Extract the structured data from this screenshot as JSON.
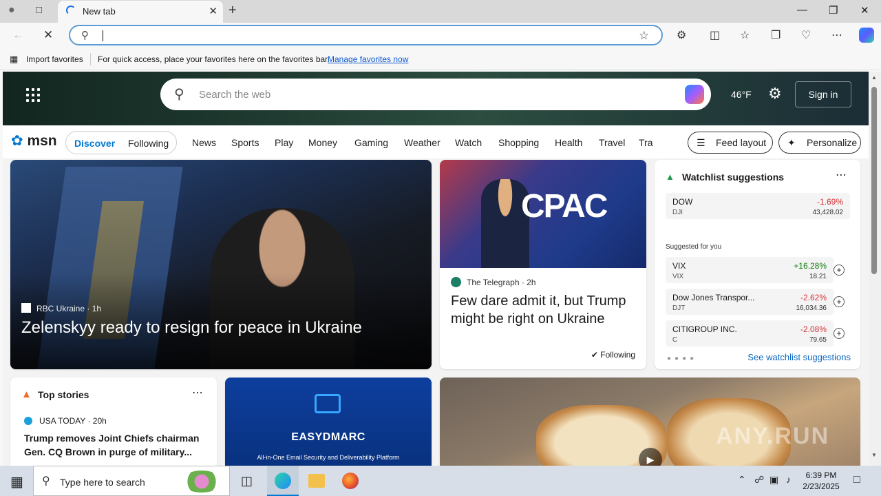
{
  "browser": {
    "tab_title": "New tab",
    "address_value": "",
    "favorites_bar": {
      "import_label": "Import favorites",
      "message": "For quick access, place your favorites here on the favorites bar.",
      "link": "Manage favorites now"
    }
  },
  "msn": {
    "search_placeholder": "Search the web",
    "temperature": "46°F",
    "sign_in": "Sign in",
    "logo": "msn",
    "tabs": {
      "discover": "Discover",
      "following": "Following"
    },
    "nav": [
      "News",
      "Sports",
      "Play",
      "Money",
      "Gaming",
      "Weather",
      "Watch",
      "Shopping",
      "Health",
      "Travel",
      "Tra"
    ],
    "feed_layout": "Feed layout",
    "personalize": "Personalize",
    "hero": {
      "source": "RBC Ukraine · 1h",
      "headline": "Zelenskyy ready to resign for peace in Ukraine"
    },
    "cpac": {
      "image_text": "CPAC",
      "source": "The Telegraph · 2h",
      "headline": "Few dare admit it, but Trump might be right on Ukraine",
      "following": "Following"
    },
    "watchlist": {
      "title": "Watchlist suggestions",
      "suggested_label": "Suggested for you",
      "see_more": "See watchlist suggestions",
      "items": [
        {
          "name": "DOW",
          "symbol": "DJI",
          "change": "-1.69%",
          "price": "43,428.02"
        },
        {
          "name": "VIX",
          "symbol": "VIX",
          "change": "+16.28%",
          "price": "18.21"
        },
        {
          "name": "Dow Jones Transpor...",
          "symbol": "DJT",
          "change": "-2.62%",
          "price": "16,034.36"
        },
        {
          "name": "CITIGROUP INC.",
          "symbol": "C",
          "change": "-2.08%",
          "price": "79.65"
        }
      ]
    },
    "top_stories": {
      "title": "Top stories",
      "source": "USA TODAY · 20h",
      "headline": "Trump removes Joint Chiefs chairman Gen. CQ Brown in purge of military..."
    },
    "ad": {
      "brand": "EASYDMARC",
      "tagline": "All-in-One Email Security and Deliverability Platform"
    },
    "watermark": "ANY.RUN"
  },
  "taskbar": {
    "search_placeholder": "Type here to search",
    "time": "6:39 PM",
    "date": "2/23/2025"
  },
  "colors": {
    "accent": "#0078d4",
    "negative": "#d13438",
    "positive": "#107c10"
  }
}
